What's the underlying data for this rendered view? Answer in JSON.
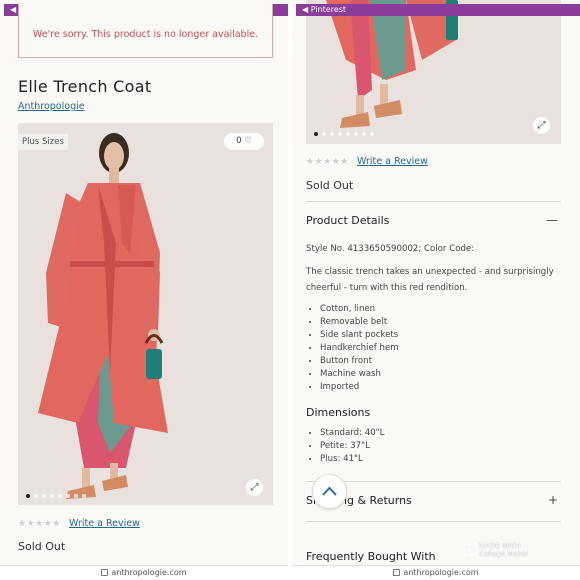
{
  "pinterest_bar": {
    "label": "◀ Pinterest"
  },
  "alert": {
    "message": "We're sorry. This product is no longer available."
  },
  "product": {
    "title": "Elle Trench Coat",
    "brand": "Anthropologie",
    "badge": "Plus Sizes",
    "favorites": "0 ♡",
    "rating_stars": "★★★★★",
    "write_review": "Write a Review",
    "status": "Sold Out",
    "carousel": {
      "slides": 8,
      "active_index": 0
    }
  },
  "details": {
    "heading": "Product Details",
    "toggle": "—",
    "style_line": "Style No. 4133650590002; Color Code:",
    "description": "The classic trench takes an unexpected - and surprisingly cheerful - turn with this red rendition.",
    "features": [
      "Cotton, linen",
      "Removable belt",
      "Side slant pockets",
      "Handkerchief hem",
      "Button front",
      "Machine wash",
      "Imported"
    ]
  },
  "dimensions": {
    "heading": "Dimensions",
    "items": [
      "Standard: 40\"L",
      "Petite: 37\"L",
      "Plus: 41\"L"
    ]
  },
  "shipping": {
    "heading": "Shipping & Returns",
    "toggle": "+"
  },
  "frequently_bought": {
    "heading": "Frequently Bought With"
  },
  "browser": {
    "url": "anthropologie.com"
  },
  "watermark": {
    "line1": "MADE WITH",
    "line2": "Collage Maker"
  },
  "colors": {
    "pinterest_bar": "#8b3d9a",
    "link": "#1f6b91",
    "alert": "#c65353",
    "coat": "#e1675f"
  }
}
